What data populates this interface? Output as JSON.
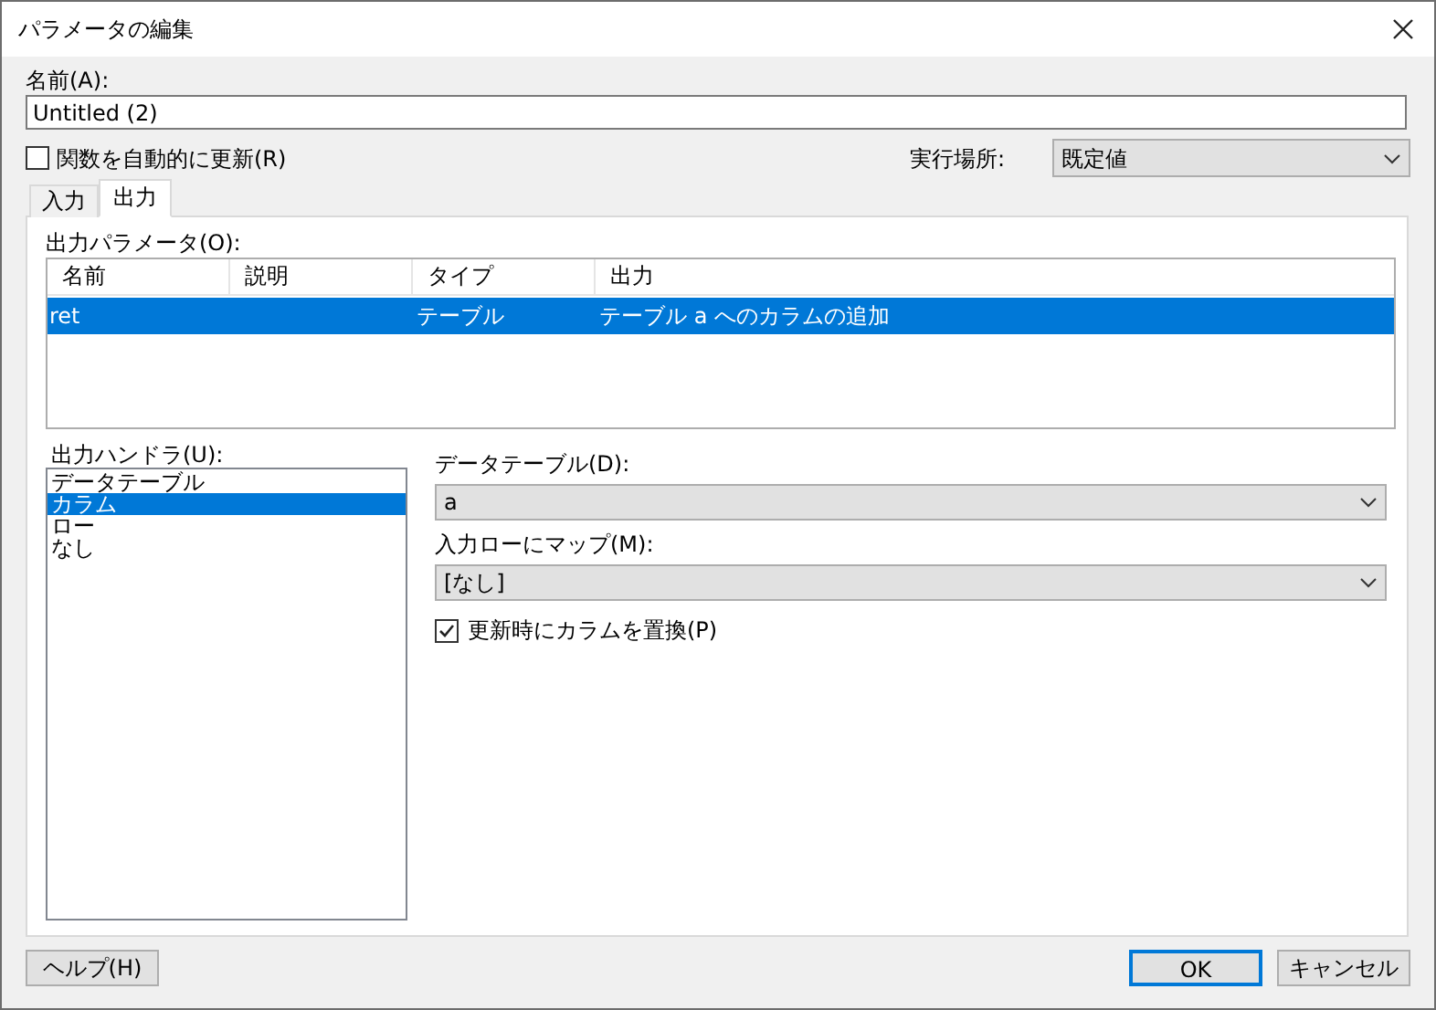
{
  "window": {
    "title": "パラメータの編集"
  },
  "name_field": {
    "label": "名前(A):",
    "value": "Untitled (2)"
  },
  "auto_update": {
    "label": "関数を自動的に更新(R)",
    "checked": false
  },
  "run_location": {
    "label": "実行場所:",
    "value": "既定値"
  },
  "tabs": [
    {
      "label": "入力",
      "selected": false
    },
    {
      "label": "出力",
      "selected": true
    }
  ],
  "output_parameters": {
    "label": "出力パラメータ(O):",
    "columns": [
      "名前",
      "説明",
      "タイプ",
      "出力"
    ],
    "rows": [
      {
        "cells": [
          "ret",
          "",
          "テーブル",
          "テーブル a へのカラムの追加"
        ],
        "selected": true
      }
    ]
  },
  "output_handlers": {
    "label": "出力ハンドラ(U):",
    "items": [
      {
        "label": "データテーブル",
        "selected": false
      },
      {
        "label": "カラム",
        "selected": true
      },
      {
        "label": "ロー",
        "selected": false
      },
      {
        "label": "なし",
        "selected": false
      }
    ]
  },
  "data_table": {
    "label": "データテーブル(D):",
    "value": "a"
  },
  "map_input_row": {
    "label": "入力ローにマップ(M):",
    "value": "[なし]"
  },
  "replace_columns": {
    "label": "更新時にカラムを置換(P)",
    "checked": true
  },
  "buttons": {
    "help": "ヘルプ(H)",
    "ok": "OK",
    "cancel": "キャンセル"
  }
}
